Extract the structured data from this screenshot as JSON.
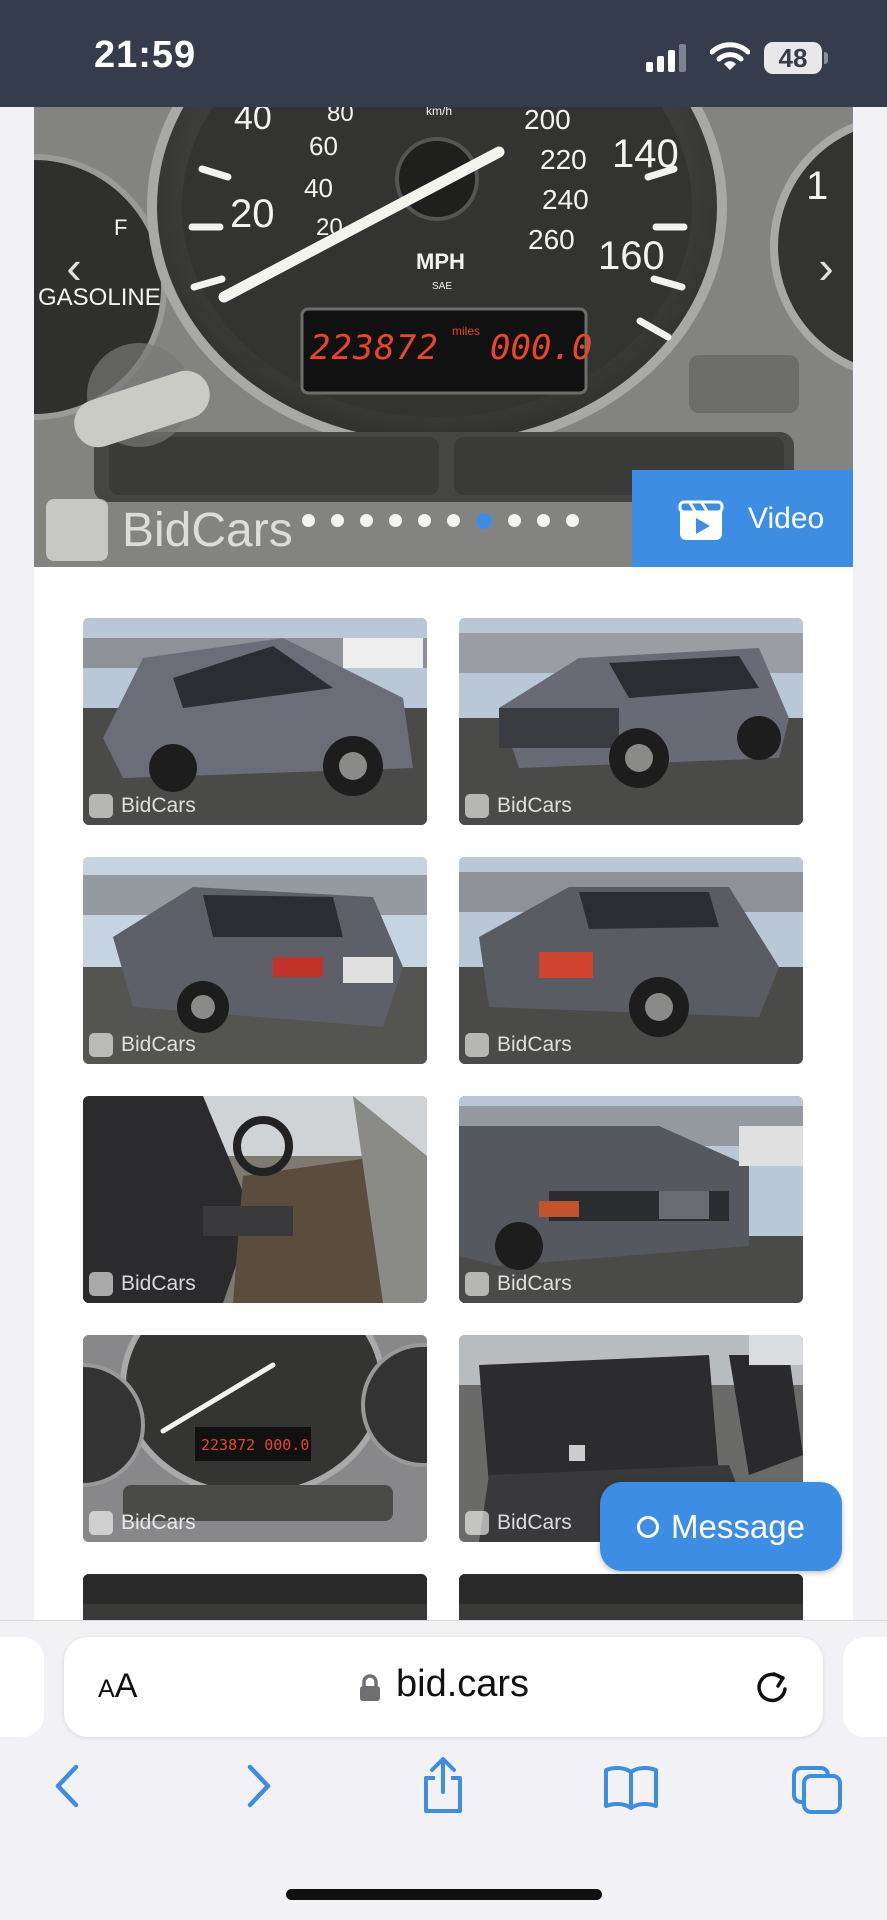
{
  "status_bar": {
    "time": "21:59",
    "battery": "48",
    "icons": [
      "cellular-signal-icon",
      "wifi-icon",
      "battery-icon"
    ]
  },
  "gallery": {
    "watermark": "BidCars",
    "video_label": "Video",
    "dots_total": 10,
    "dots_active_index": 6,
    "hero_odometer": "223872",
    "hero_odometer_unit": "miles",
    "hero_trip": "000.0",
    "hero_gauge": {
      "left_labels": [
        "40",
        "80",
        "60",
        "40",
        "20",
        "20"
      ],
      "right_labels": [
        "km/h",
        "200",
        "220",
        "140",
        "240",
        "260",
        "160"
      ],
      "unit": "MPH",
      "sub_unit": "SAE",
      "fuel_label": "GASOLINE",
      "fuel_mark": "F",
      "side_mark": "1"
    },
    "thumbnails": [
      {
        "label": "BidCars",
        "scene": "car-side-front"
      },
      {
        "label": "BidCars",
        "scene": "car-front-quarter"
      },
      {
        "label": "BidCars",
        "scene": "car-rear-quarter-left"
      },
      {
        "label": "BidCars",
        "scene": "car-rear-quarter-right"
      },
      {
        "label": "BidCars",
        "scene": "interior-front"
      },
      {
        "label": "BidCars",
        "scene": "car-front-close"
      },
      {
        "label": "BidCars",
        "scene": "gauge-cluster"
      },
      {
        "label": "BidCars",
        "scene": "interior-rear-seat"
      },
      {
        "label": "",
        "scene": "partial-row"
      },
      {
        "label": "",
        "scene": "partial-row"
      }
    ]
  },
  "message_button": {
    "label": "Message"
  },
  "browser": {
    "aa_big": "A",
    "aa_small": "A",
    "url": "bid.cars"
  },
  "toolbar": {
    "items": [
      "back-icon",
      "forward-icon",
      "share-icon",
      "bookmarks-icon",
      "tabs-icon"
    ]
  },
  "colors": {
    "status_bar_bg": "#353c4c",
    "accent": "#3e8de5",
    "browser_bg": "#f2f2f6",
    "odometer_digits": "#e8452c"
  }
}
